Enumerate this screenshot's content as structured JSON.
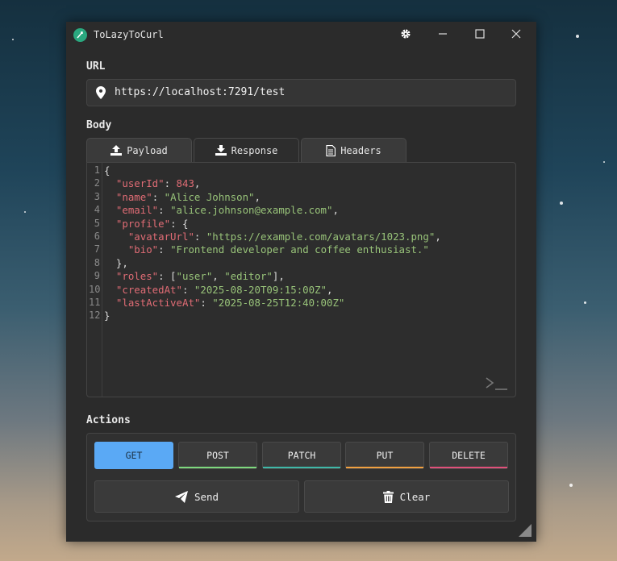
{
  "window": {
    "title": "ToLazyToCurl"
  },
  "url_section": {
    "label": "URL",
    "value": "https://localhost:7291/test"
  },
  "body_section": {
    "label": "Body",
    "tabs": [
      {
        "label": "Payload",
        "icon": "upload-icon"
      },
      {
        "label": "Response",
        "icon": "download-icon",
        "active": true
      },
      {
        "label": "Headers",
        "icon": "document-icon"
      }
    ]
  },
  "editor": {
    "line_numbers": [
      "1",
      "2",
      "3",
      "4",
      "5",
      "6",
      "7",
      "8",
      "9",
      "10",
      "11",
      "12"
    ],
    "lines": [
      [
        [
          "p",
          "{"
        ]
      ],
      [
        [
          "p",
          "  "
        ],
        [
          "k",
          "\"userId\""
        ],
        [
          "p",
          ": "
        ],
        [
          "n",
          "843"
        ],
        [
          "p",
          ","
        ]
      ],
      [
        [
          "p",
          "  "
        ],
        [
          "k",
          "\"name\""
        ],
        [
          "p",
          ": "
        ],
        [
          "s",
          "\"Alice Johnson\""
        ],
        [
          "p",
          ","
        ]
      ],
      [
        [
          "p",
          "  "
        ],
        [
          "k",
          "\"email\""
        ],
        [
          "p",
          ": "
        ],
        [
          "s",
          "\"alice.johnson@example.com\""
        ],
        [
          "p",
          ","
        ]
      ],
      [
        [
          "p",
          "  "
        ],
        [
          "k",
          "\"profile\""
        ],
        [
          "p",
          ": {"
        ]
      ],
      [
        [
          "p",
          "    "
        ],
        [
          "k",
          "\"avatarUrl\""
        ],
        [
          "p",
          ": "
        ],
        [
          "s",
          "\"https://example.com/avatars/1023.png\""
        ],
        [
          "p",
          ","
        ]
      ],
      [
        [
          "p",
          "    "
        ],
        [
          "k",
          "\"bio\""
        ],
        [
          "p",
          ": "
        ],
        [
          "s",
          "\"Frontend developer and coffee enthusiast.\""
        ]
      ],
      [
        [
          "p",
          "  },"
        ]
      ],
      [
        [
          "p",
          "  "
        ],
        [
          "k",
          "\"roles\""
        ],
        [
          "p",
          ": ["
        ],
        [
          "s",
          "\"user\""
        ],
        [
          "p",
          ", "
        ],
        [
          "s",
          "\"editor\""
        ],
        [
          "p",
          "],"
        ]
      ],
      [
        [
          "p",
          "  "
        ],
        [
          "k",
          "\"createdAt\""
        ],
        [
          "p",
          ": "
        ],
        [
          "s",
          "\"2025-08-20T09:15:00Z\""
        ],
        [
          "p",
          ","
        ]
      ],
      [
        [
          "p",
          "  "
        ],
        [
          "k",
          "\"lastActiveAt\""
        ],
        [
          "p",
          ": "
        ],
        [
          "s",
          "\"2025-08-25T12:40:00Z\""
        ]
      ],
      [
        [
          "p",
          "}"
        ]
      ]
    ]
  },
  "actions": {
    "label": "Actions",
    "methods": [
      {
        "label": "GET",
        "selected": true,
        "color": "#5aa9f5"
      },
      {
        "label": "POST",
        "color": "#7dd87d"
      },
      {
        "label": "PATCH",
        "color": "#3fb8a8"
      },
      {
        "label": "PUT",
        "color": "#f0a040"
      },
      {
        "label": "DELETE",
        "color": "#e0507a"
      }
    ],
    "send_label": "Send",
    "clear_label": "Clear"
  }
}
